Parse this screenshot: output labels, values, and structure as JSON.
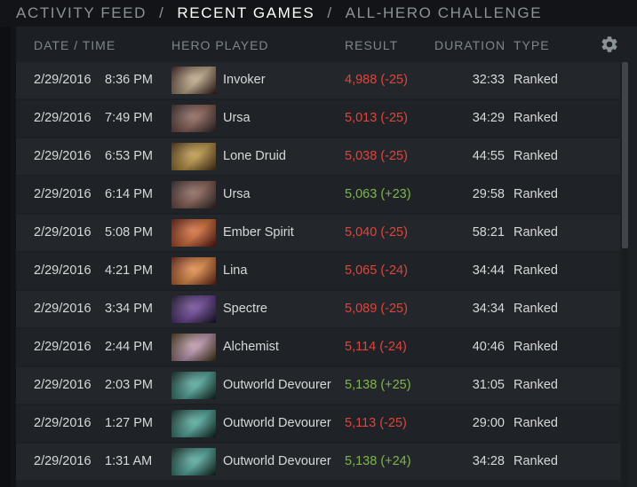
{
  "nav": {
    "tabs": [
      {
        "label": "ACTIVITY FEED",
        "active": false
      },
      {
        "label": "RECENT GAMES",
        "active": true
      },
      {
        "label": "ALL-HERO CHALLENGE",
        "active": false
      }
    ],
    "separator": "/"
  },
  "table": {
    "headers": {
      "date_time": "DATE / TIME",
      "hero": "HERO PLAYED",
      "result": "RESULT",
      "duration": "DURATION",
      "type": "TYPE"
    },
    "settings_icon": "gear-icon",
    "rows": [
      {
        "date": "2/29/2016",
        "time": "8:36 PM",
        "hero": "Invoker",
        "result": "4,988 (-25)",
        "outcome": "loss",
        "duration": "32:33",
        "type": "Ranked",
        "portrait_colors": [
          "#3a1d1a",
          "#c9b08a"
        ]
      },
      {
        "date": "2/29/2016",
        "time": "7:49 PM",
        "hero": "Ursa",
        "result": "5,013 (-25)",
        "outcome": "loss",
        "duration": "34:29",
        "type": "Ranked",
        "portrait_colors": [
          "#3b2a2c",
          "#8a5a4c"
        ]
      },
      {
        "date": "2/29/2016",
        "time": "6:53 PM",
        "hero": "Lone Druid",
        "result": "5,038 (-25)",
        "outcome": "loss",
        "duration": "44:55",
        "type": "Ranked",
        "portrait_colors": [
          "#5a3a14",
          "#c89a3c"
        ]
      },
      {
        "date": "2/29/2016",
        "time": "6:14 PM",
        "hero": "Ursa",
        "result": "5,063 (+23)",
        "outcome": "win",
        "duration": "29:58",
        "type": "Ranked",
        "portrait_colors": [
          "#3b2a2c",
          "#8a5a4c"
        ]
      },
      {
        "date": "2/29/2016",
        "time": "5:08 PM",
        "hero": "Ember Spirit",
        "result": "5,040 (-25)",
        "outcome": "loss",
        "duration": "58:21",
        "type": "Ranked",
        "portrait_colors": [
          "#6b1a0e",
          "#e0682a"
        ]
      },
      {
        "date": "2/29/2016",
        "time": "4:21 PM",
        "hero": "Lina",
        "result": "5,065 (-24)",
        "outcome": "loss",
        "duration": "34:44",
        "type": "Ranked",
        "portrait_colors": [
          "#7a2a14",
          "#f08a3a"
        ]
      },
      {
        "date": "2/29/2016",
        "time": "3:34 PM",
        "hero": "Spectre",
        "result": "5,089 (-25)",
        "outcome": "loss",
        "duration": "34:34",
        "type": "Ranked",
        "portrait_colors": [
          "#1a1430",
          "#6a3a9a"
        ]
      },
      {
        "date": "2/29/2016",
        "time": "2:44 PM",
        "hero": "Alchemist",
        "result": "5,114 (-24)",
        "outcome": "loss",
        "duration": "40:46",
        "type": "Ranked",
        "portrait_colors": [
          "#4a3a14",
          "#c89ab8"
        ]
      },
      {
        "date": "2/29/2016",
        "time": "2:03 PM",
        "hero": "Outworld Devourer",
        "result": "5,138 (+25)",
        "outcome": "win",
        "duration": "31:05",
        "type": "Ranked",
        "portrait_colors": [
          "#0e2a26",
          "#4ab0a0"
        ]
      },
      {
        "date": "2/29/2016",
        "time": "1:27 PM",
        "hero": "Outworld Devourer",
        "result": "5,113 (-25)",
        "outcome": "loss",
        "duration": "29:00",
        "type": "Ranked",
        "portrait_colors": [
          "#0e2a26",
          "#4ab0a0"
        ]
      },
      {
        "date": "2/29/2016",
        "time": "1:31 AM",
        "hero": "Outworld Devourer",
        "result": "5,138 (+24)",
        "outcome": "win",
        "duration": "34:28",
        "type": "Ranked",
        "portrait_colors": [
          "#0e2a26",
          "#4ab0a0"
        ]
      }
    ]
  },
  "colors": {
    "loss": "#e0443b",
    "win": "#7fb54a"
  }
}
